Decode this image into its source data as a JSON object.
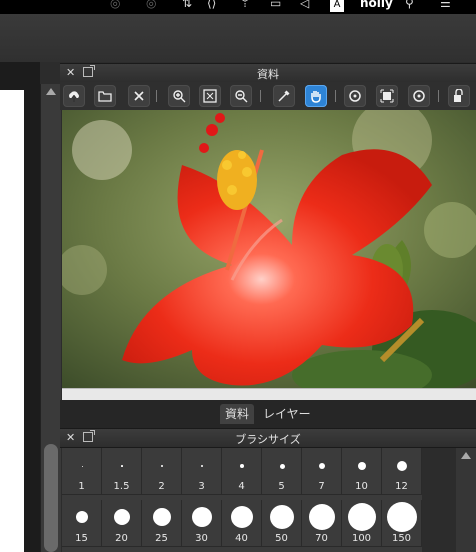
{
  "menubar": {
    "user": "holly"
  },
  "materials_panel": {
    "title": "資料",
    "tools": [
      {
        "name": "open-cloud",
        "icon": "cloud-upload-icon"
      },
      {
        "name": "open-folder",
        "icon": "folder-icon"
      },
      {
        "name": "close-image",
        "icon": "close-icon"
      },
      {
        "name": "zoom-in",
        "icon": "zoom-in-icon"
      },
      {
        "name": "fit-window",
        "icon": "fit-screen-icon"
      },
      {
        "name": "zoom-out",
        "icon": "zoom-out-icon"
      },
      {
        "name": "eyedropper",
        "icon": "eyedropper-icon"
      },
      {
        "name": "hand",
        "icon": "hand-icon",
        "active": true
      },
      {
        "name": "rotate-left",
        "icon": "rotate-left-icon"
      },
      {
        "name": "reset",
        "icon": "reset-icon"
      },
      {
        "name": "rotate-right",
        "icon": "rotate-right-icon"
      },
      {
        "name": "lock",
        "icon": "lock-icon"
      }
    ],
    "image_subject": "red hibiscus flower"
  },
  "tabs": [
    {
      "label": "資料",
      "active": true
    },
    {
      "label": "レイヤー",
      "active": false
    }
  ],
  "brush_panel": {
    "title": "ブラシサイズ",
    "sizes": [
      "1",
      "1.5",
      "2",
      "3",
      "4",
      "5",
      "7",
      "10",
      "12",
      "15",
      "20",
      "25",
      "30",
      "40",
      "50",
      "70",
      "100",
      "150"
    ]
  },
  "colors": {
    "accent": "#2e84d6",
    "flower": "#e8321c"
  }
}
